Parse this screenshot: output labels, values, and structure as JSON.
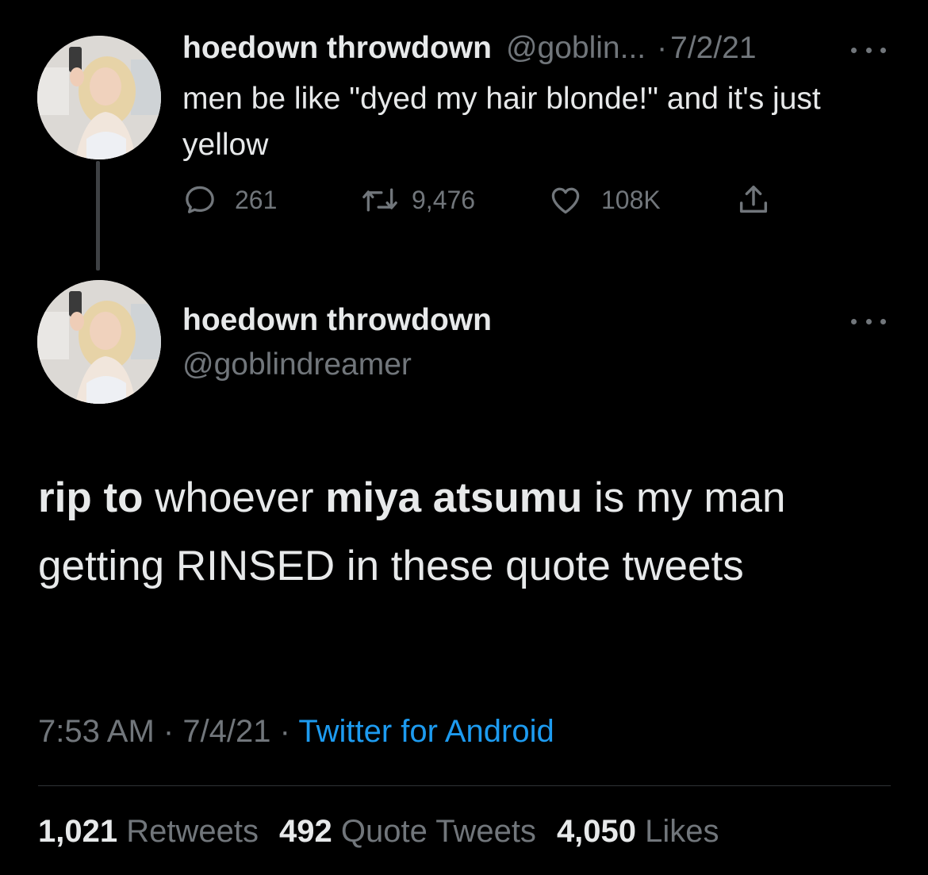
{
  "tweet1": {
    "display_name": "hoedown throwdown",
    "handle": "@goblin...",
    "separator": "·",
    "date": "7/2/21",
    "text": "men be like \"dyed my hair blonde!\" and it's just yellow",
    "actions": {
      "replies": "261",
      "retweets": "9,476",
      "likes": "108K"
    },
    "icons": [
      "reply-icon",
      "retweet-icon",
      "like-icon",
      "share-icon",
      "more-icon"
    ]
  },
  "tweet2": {
    "display_name": "hoedown throwdown",
    "handle": "@goblindreamer",
    "text_parts": {
      "p1": "rip to",
      "p2": " whoever ",
      "p3": "miya atsumu",
      "p4": " is my man getting RINSED in these quote tweets"
    },
    "time": "7:53 AM",
    "sep1": " · ",
    "date": "7/4/21",
    "sep2": " · ",
    "source": "Twitter for Android",
    "stats": {
      "retweets_count": "1,021",
      "retweets_label": "Retweets",
      "quotes_count": "492",
      "quotes_label": "Quote Tweets",
      "likes_count": "4,050",
      "likes_label": "Likes"
    }
  },
  "colors": {
    "background": "#000000",
    "text_primary": "#e7e9ea",
    "text_secondary": "#71767b",
    "link": "#1d9bf0"
  }
}
